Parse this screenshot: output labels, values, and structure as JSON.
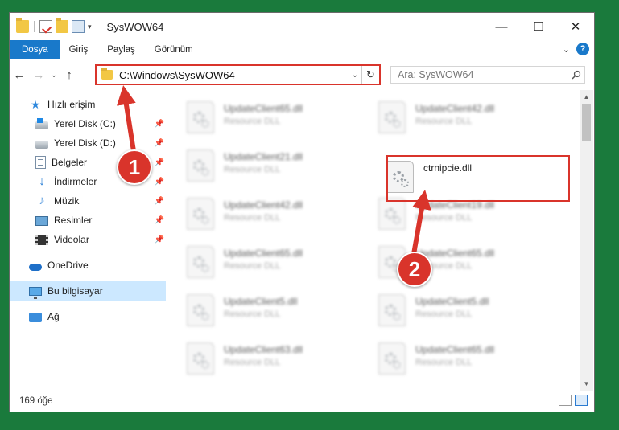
{
  "window": {
    "title": "SysWOW64",
    "minimize_glyph": "—",
    "maximize_glyph": "☐",
    "close_glyph": "✕"
  },
  "ribbon": {
    "tabs": [
      "Dosya",
      "Giriş",
      "Paylaş",
      "Görünüm"
    ],
    "help_glyph": "?"
  },
  "address": {
    "path": "C:\\Windows\\SysWOW64",
    "search_placeholder": "Ara: SysWOW64"
  },
  "nav": {
    "quick_access": "Hızlı erişim",
    "items": [
      {
        "label": "Yerel Disk (C:)",
        "icon": "drive-c-icon",
        "pinned": true
      },
      {
        "label": "Yerel Disk (D:)",
        "icon": "drive-icon",
        "pinned": true
      },
      {
        "label": "Belgeler",
        "icon": "documents-icon",
        "pinned": true
      },
      {
        "label": "İndirmeler",
        "icon": "downloads-icon",
        "pinned": true
      },
      {
        "label": "Müzik",
        "icon": "music-icon",
        "pinned": true
      },
      {
        "label": "Resimler",
        "icon": "pictures-icon",
        "pinned": true
      },
      {
        "label": "Videolar",
        "icon": "videos-icon",
        "pinned": true
      }
    ],
    "onedrive": "OneDrive",
    "this_pc": "Bu bilgisayar",
    "network": "Ağ"
  },
  "files": [
    {
      "name": "UpdateClient65.dll",
      "type": "Resource DLL"
    },
    {
      "name": "UpdateClient42.dll",
      "type": "Resource DLL"
    },
    {
      "name": "UpdateClient21.dll",
      "type": "Resource DLL"
    },
    {
      "name": "ctrnipcie.dll",
      "type": ""
    },
    {
      "name": "UpdateClient42.dll",
      "type": "Resource DLL"
    },
    {
      "name": "UpdateClient19.dll",
      "type": "Resource DLL"
    },
    {
      "name": "UpdateClient65.dll",
      "type": "Resource DLL"
    },
    {
      "name": "UpdateClient65.dll",
      "type": "Resource DLL"
    },
    {
      "name": "UpdateClient5.dll",
      "type": "Resource DLL"
    },
    {
      "name": "UpdateClient5.dll",
      "type": "Resource DLL"
    },
    {
      "name": "UpdateClient63.dll",
      "type": "Resource DLL"
    },
    {
      "name": "UpdateClient65.dll",
      "type": "Resource DLL"
    }
  ],
  "status": {
    "item_count": "169 öğe"
  },
  "annotations": {
    "step1": "1",
    "step2": "2"
  },
  "colors": {
    "accent": "#1979ca",
    "annotation_red": "#d9342b",
    "desktop_green": "#1a7a3c"
  }
}
